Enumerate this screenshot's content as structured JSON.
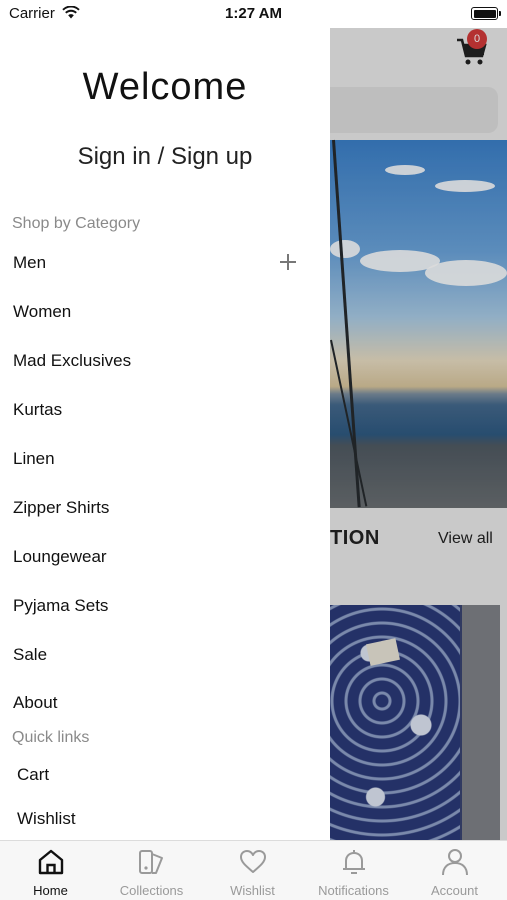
{
  "status_bar": {
    "carrier": "Carrier",
    "time": "1:27 AM"
  },
  "background_screen": {
    "cart_count": "0",
    "section_title_partial": "TION",
    "view_all": "View all"
  },
  "drawer": {
    "title": "Welcome",
    "signin": "Sign in / Sign up",
    "shop_by_category_header": "Shop by Category",
    "categories": [
      "Men",
      "Women",
      "Mad Exclusives",
      "Kurtas",
      "Linen",
      "Zipper Shirts",
      "Loungewear",
      "Pyjama Sets",
      "Sale",
      "About"
    ],
    "quick_links_header": "Quick links",
    "quick_links": [
      "Cart",
      "Wishlist"
    ]
  },
  "tab_bar": {
    "tabs": [
      {
        "label": "Home",
        "icon": "home-icon",
        "active": true
      },
      {
        "label": "Collections",
        "icon": "collections-icon",
        "active": false
      },
      {
        "label": "Wishlist",
        "icon": "heart-icon",
        "active": false
      },
      {
        "label": "Notifications",
        "icon": "bell-icon",
        "active": false
      },
      {
        "label": "Account",
        "icon": "person-icon",
        "active": false
      }
    ]
  },
  "colors": {
    "badge": "#d23a3a",
    "active_tab": "#111111",
    "inactive_tab": "#9a9a9a"
  }
}
